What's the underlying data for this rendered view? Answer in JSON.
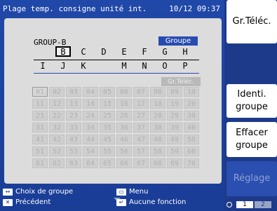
{
  "header": {
    "title": "Plage temp. consigne unité int.",
    "datetime": "10/12 09:37"
  },
  "group": {
    "name": "GROUP-B",
    "tab_groupe": "Groupe",
    "tab_grteleq": "Gr.Téléc."
  },
  "letters_row1": [
    "",
    "B",
    "C",
    "D",
    "E",
    "F",
    "G",
    "H"
  ],
  "letters_row2": [
    "I",
    "J",
    "K",
    "",
    "M",
    "N",
    "O",
    "P"
  ],
  "selected_letter": "B",
  "numbers": [
    "01",
    "02",
    "03",
    "04",
    "05",
    "06",
    "07",
    "08",
    "09",
    "10",
    "11",
    "12",
    "13",
    "14",
    "15",
    "16",
    "17",
    "18",
    "19",
    "20",
    "21",
    "22",
    "23",
    "24",
    "25",
    "26",
    "27",
    "28",
    "29",
    "30",
    "31",
    "32",
    "33",
    "34",
    "35",
    "36",
    "37",
    "38",
    "39",
    "40",
    "41",
    "42",
    "43",
    "44",
    "45",
    "46",
    "47",
    "48",
    "49",
    "50",
    "51",
    "52",
    "53",
    "54",
    "55",
    "56",
    "57",
    "58",
    "59",
    "60",
    "61",
    "62",
    "63",
    "64",
    "65",
    "66",
    "67",
    "68",
    "69",
    "70"
  ],
  "footer": {
    "choix": "Choix de groupe",
    "precedent": "Précédent",
    "menu": "Menu",
    "aucune": "Aucune fonction"
  },
  "side": {
    "gr_teleq": "Gr.Téléc.",
    "identi_l1": "Identi.",
    "identi_l2": "groupe",
    "effacer_l1": "Effacer",
    "effacer_l2": "groupe",
    "reglage": "Réglage"
  },
  "pager": {
    "p1": "1",
    "p2": "2"
  },
  "colors": {
    "background": "#1d3a8a",
    "panel": "#dcdcdc",
    "accent": "#274bb0"
  }
}
